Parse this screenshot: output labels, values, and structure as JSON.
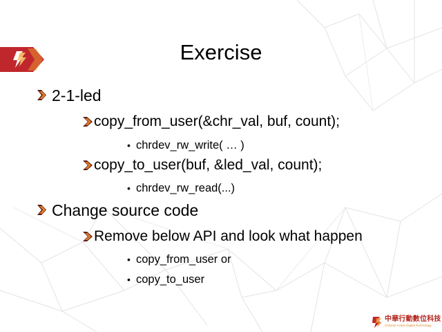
{
  "slide": {
    "title": "Exercise",
    "items": [
      {
        "level": 1,
        "text": "2-1-led"
      },
      {
        "level": 2,
        "text": "copy_from_user(&chr_val, buf, count);"
      },
      {
        "level": 3,
        "text": "chrdev_rw_write( … )"
      },
      {
        "level": 2,
        "text": "copy_to_user(buf, &led_val, count);"
      },
      {
        "level": 3,
        "text": "chrdev_rw_read(...)"
      },
      {
        "level": 1,
        "text": "Change source code"
      },
      {
        "level": 2,
        "text": "Remove below API and look what happen"
      },
      {
        "level": 3,
        "text": "copy_from_user or"
      },
      {
        "level": 3,
        "text": "copy_to_user"
      }
    ]
  },
  "logo": {
    "name": "中華行動數位科技",
    "subtitle": "Chinese Action Digital Technology"
  },
  "colors": {
    "accent_red": "#c0272d",
    "accent_orange": "#e8942f",
    "bullet_dark": "#5a1d10",
    "bullet_orange": "#e07b2a",
    "background_lines": "#e3e3e3"
  },
  "icons": {
    "level1_bullet": "double-arrow-bullet-icon",
    "level2_bullet": "arrow-bullet-icon",
    "level3_bullet": "dot-bullet"
  }
}
